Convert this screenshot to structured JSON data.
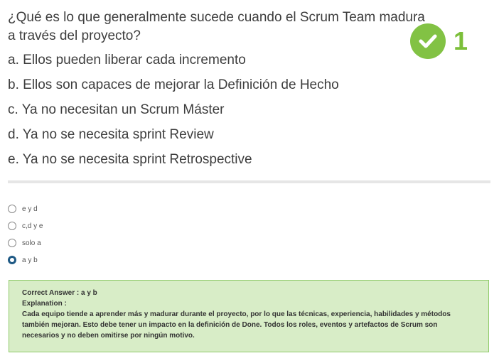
{
  "question": {
    "text": "¿Qué es lo que generalmente sucede cuando el Scrum Team madura a través del proyecto?",
    "options": [
      "a. Ellos pueden liberar cada incremento",
      "b. Ellos son capaces de mejorar la Definición de Hecho",
      "c. Ya no necesitan un Scrum Máster",
      "d. Ya no se necesita sprint Review",
      "e. Ya no se necesita sprint Retrospective"
    ]
  },
  "badge": {
    "icon": "check-circle-icon",
    "count": "1",
    "color": "#7cbf3a"
  },
  "choices": [
    {
      "label": "e y d",
      "selected": false
    },
    {
      "label": "c,d y e",
      "selected": false
    },
    {
      "label": "solo a",
      "selected": false
    },
    {
      "label": "a y b",
      "selected": true
    }
  ],
  "feedback": {
    "correct_answer": "Correct Answer : a y b",
    "explanation_label": "Explanation :",
    "explanation": "Cada equipo tiende a aprender más y madurar durante el proyecto, por lo que las técnicas, experiencia, habilidades y métodos también mejoran. Esto debe tener un impacto en la definición de Done. Todos los roles, eventos y artefactos de Scrum son necesarios y no deben omitirse por ningún motivo."
  }
}
